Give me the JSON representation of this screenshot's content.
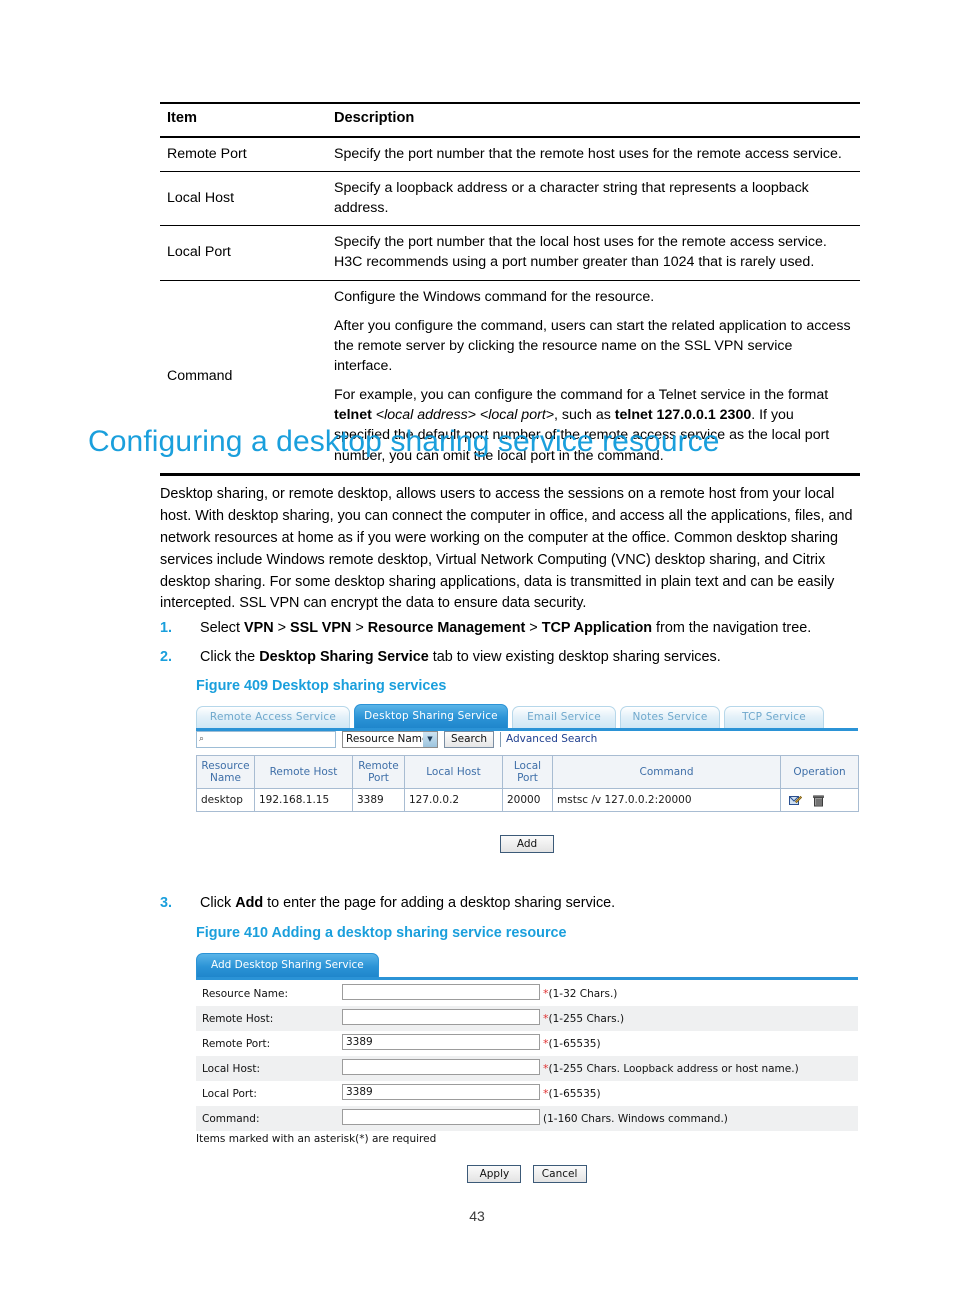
{
  "spec_table": {
    "headers": [
      "Item",
      "Description"
    ],
    "rows": [
      {
        "item": "Remote Port",
        "paragraphs": [
          "Specify the port number that the remote host uses for the remote access service."
        ]
      },
      {
        "item": "Local Host",
        "paragraphs": [
          "Specify a loopback address or a character string that represents a loopback address."
        ]
      },
      {
        "item": "Local Port",
        "paragraphs": [
          "Specify the port number that the local host uses for the remote access service. H3C recommends using a port number greater than 1024 that is rarely used."
        ]
      },
      {
        "item": "Command",
        "paragraphs": [
          "Configure the Windows command for the resource.",
          "After you configure the command, users can start the related application to access the remote server by clicking the resource name on the SSL VPN service interface.",
          "For example, you can configure the command for a Telnet service in the format telnet <local address> <local port>, such as telnet 127.0.0.1 2300. If you specified the default port number of the remote access service as the local port number, you can omit the local port in the command."
        ]
      }
    ]
  },
  "heading": "Configuring a desktop sharing service resource",
  "intro_paragraph": "Desktop sharing, or remote desktop, allows users to access the sessions on a remote host from your local host. With desktop sharing, you can connect the computer in office, and access all the applications, files, and network resources at home as if you were working on the computer at the office. Common desktop sharing services include Windows remote desktop, Virtual Network Computing (VNC) desktop sharing, and Citrix desktop sharing. For some desktop sharing applications, data is transmitted in plain text and can be easily intercepted. SSL VPN can encrypt the data to ensure data security.",
  "steps": [
    {
      "num": "1.",
      "text_prefix": "Select ",
      "bold1": "VPN",
      "mid1": " > ",
      "bold2": "SSL VPN",
      "mid2": " > ",
      "bold3": "Resource Management",
      "mid3": " > ",
      "bold4": "TCP Application",
      "text_suffix": " from the navigation tree."
    },
    {
      "num": "2.",
      "text_prefix": "Click the ",
      "bold1": "Desktop Sharing Service",
      "text_suffix": " tab to view existing desktop sharing services."
    },
    {
      "num": "3.",
      "text_prefix": "Click ",
      "bold1": "Add",
      "text_suffix": " to enter the page for adding a desktop sharing service."
    }
  ],
  "figure409": {
    "caption": "Figure 409 Desktop sharing services",
    "tabs": [
      {
        "label": "Remote Access Service",
        "active": false
      },
      {
        "label": "Desktop Sharing Service",
        "active": true
      },
      {
        "label": "Email Service",
        "active": false
      },
      {
        "label": "Notes Service",
        "active": false
      },
      {
        "label": "TCP Service",
        "active": false
      }
    ],
    "search": {
      "query_value": "",
      "magnifier_icon": "search-icon",
      "field_selected": "Resource Name",
      "dropdown_icon": "chevron-down-icon",
      "search_button": "Search",
      "advanced_link": "Advanced Search"
    },
    "table": {
      "headers": [
        "Resource Name",
        "Remote Host",
        "Remote Port",
        "Local Host",
        "Local Port",
        "Command",
        "Operation"
      ],
      "rows": [
        {
          "resource_name": "desktop",
          "remote_host": "192.168.1.15",
          "remote_port": "3389",
          "local_host": "127.0.0.2",
          "local_port": "20000",
          "command": "mstsc /v 127.0.0.2:20000",
          "operation_icons": [
            "edit-icon",
            "delete-icon"
          ]
        }
      ]
    },
    "add_button": "Add"
  },
  "figure410": {
    "caption": "Figure 410 Adding a desktop sharing service resource",
    "panel_tab": "Add Desktop Sharing Service",
    "fields": [
      {
        "label": "Resource Name:",
        "value": "",
        "required": true,
        "hint": "(1-32 Chars.)"
      },
      {
        "label": "Remote Host:",
        "value": "",
        "required": true,
        "hint": "(1-255 Chars.)"
      },
      {
        "label": "Remote Port:",
        "value": "3389",
        "required": true,
        "hint": "(1-65535)"
      },
      {
        "label": "Local Host:",
        "value": "",
        "required": true,
        "hint": "(1-255 Chars. Loopback address or host name.)"
      },
      {
        "label": "Local Port:",
        "value": "3389",
        "required": true,
        "hint": "(1-65535)"
      },
      {
        "label": "Command:",
        "value": "",
        "required": false,
        "hint": "(1-160 Chars. Windows command.)"
      }
    ],
    "note": "Items marked with an asterisk(*) are required",
    "apply_button": "Apply",
    "cancel_button": "Cancel"
  },
  "page_number": "43",
  "colors": {
    "heading_blue": "#1a9fdc",
    "tab_active_blue": "#2b93d6",
    "required_red": "#e03131",
    "link_blue": "#1f3f8f"
  }
}
